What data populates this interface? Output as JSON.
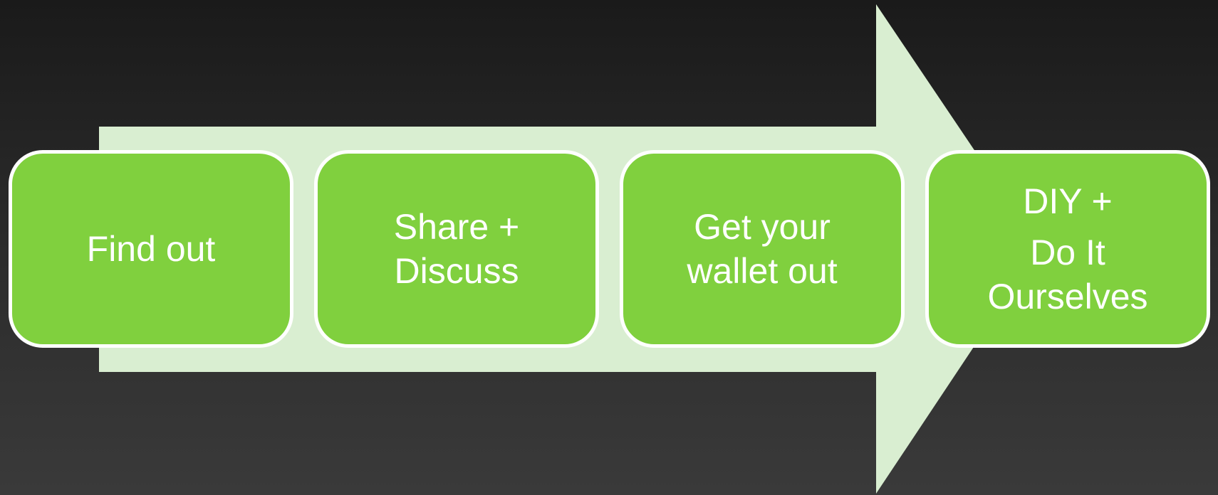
{
  "colors": {
    "background_top": "#1a1a1a",
    "background_bottom": "#3a3a3a",
    "arrow_fill": "#d9eed1",
    "box_fill": "#80d03e",
    "box_border": "#ffffff",
    "text": "#ffffff"
  },
  "steps": [
    {
      "lines": [
        "Find out"
      ]
    },
    {
      "lines": [
        "Share +",
        "Discuss"
      ]
    },
    {
      "lines": [
        "Get your",
        "wallet out"
      ]
    },
    {
      "lines": [
        "DIY +",
        "Do It",
        "Ourselves"
      ]
    }
  ]
}
